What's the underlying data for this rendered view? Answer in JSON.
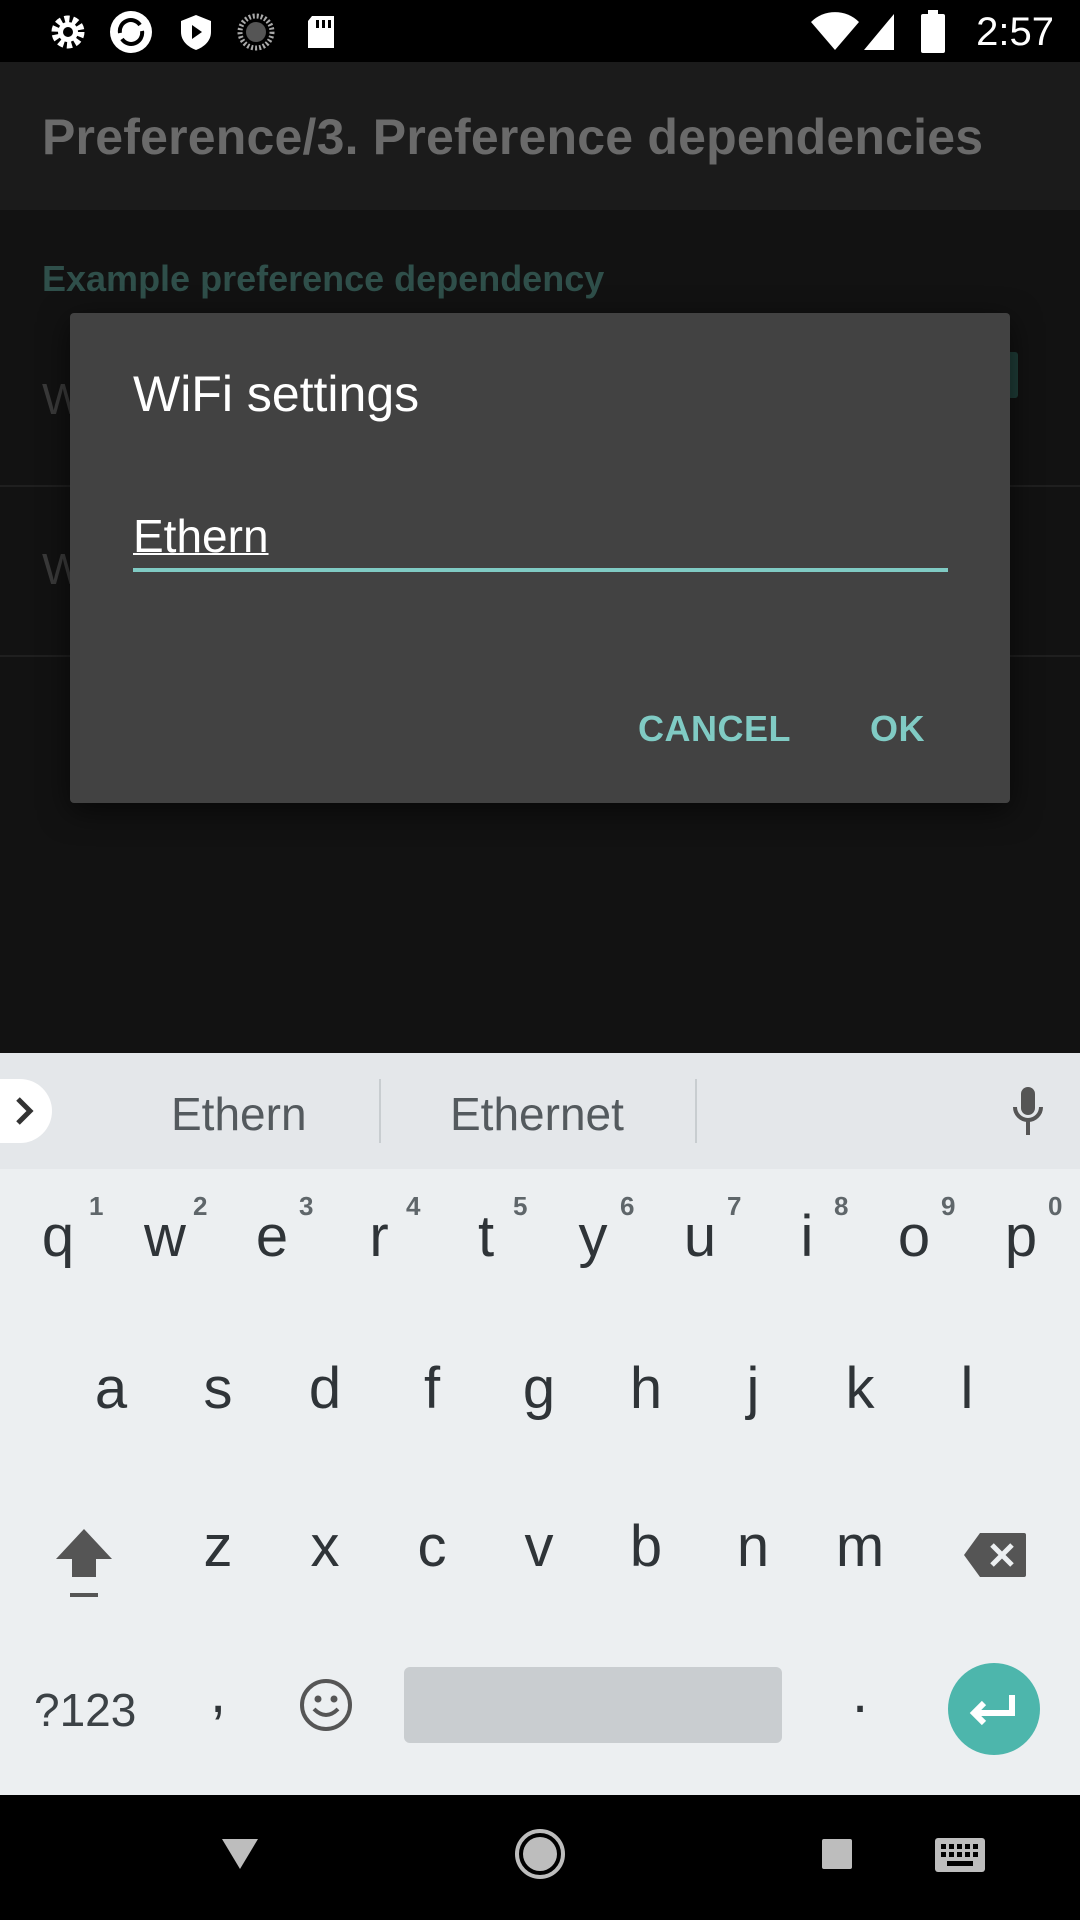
{
  "status_bar": {
    "time": "2:57",
    "left_icons": [
      "settings-icon",
      "sync-icon",
      "shield-icon",
      "loading-icon",
      "sd-card-icon"
    ],
    "right_icons": [
      "wifi-icon",
      "signal-icon",
      "battery-icon"
    ]
  },
  "app": {
    "title": "Preference/3. Preference dependencies",
    "category": "Example preference dependency",
    "rows": [
      {
        "label_visible": "W"
      },
      {
        "label_visible": "W"
      }
    ]
  },
  "dialog": {
    "title": "WiFi settings",
    "input_value": "Ethern",
    "cancel_label": "CANCEL",
    "ok_label": "OK",
    "accent_color": "#80cbc4"
  },
  "keyboard": {
    "suggestions": [
      "Ethern",
      "Ethernet"
    ],
    "row1": [
      "q",
      "w",
      "e",
      "r",
      "t",
      "y",
      "u",
      "i",
      "o",
      "p"
    ],
    "row1_hints": [
      "1",
      "2",
      "3",
      "4",
      "5",
      "6",
      "7",
      "8",
      "9",
      "0"
    ],
    "row2": [
      "a",
      "s",
      "d",
      "f",
      "g",
      "h",
      "j",
      "k",
      "l"
    ],
    "row3": [
      "z",
      "x",
      "c",
      "v",
      "b",
      "n",
      "m"
    ],
    "symbols_label": "?123",
    "comma": ",",
    "period": ".",
    "enter_color": "#4db6ac"
  },
  "nav_bar": {
    "icons": [
      "back-icon",
      "home-icon",
      "recents-icon",
      "keyboard-switch-icon"
    ]
  }
}
